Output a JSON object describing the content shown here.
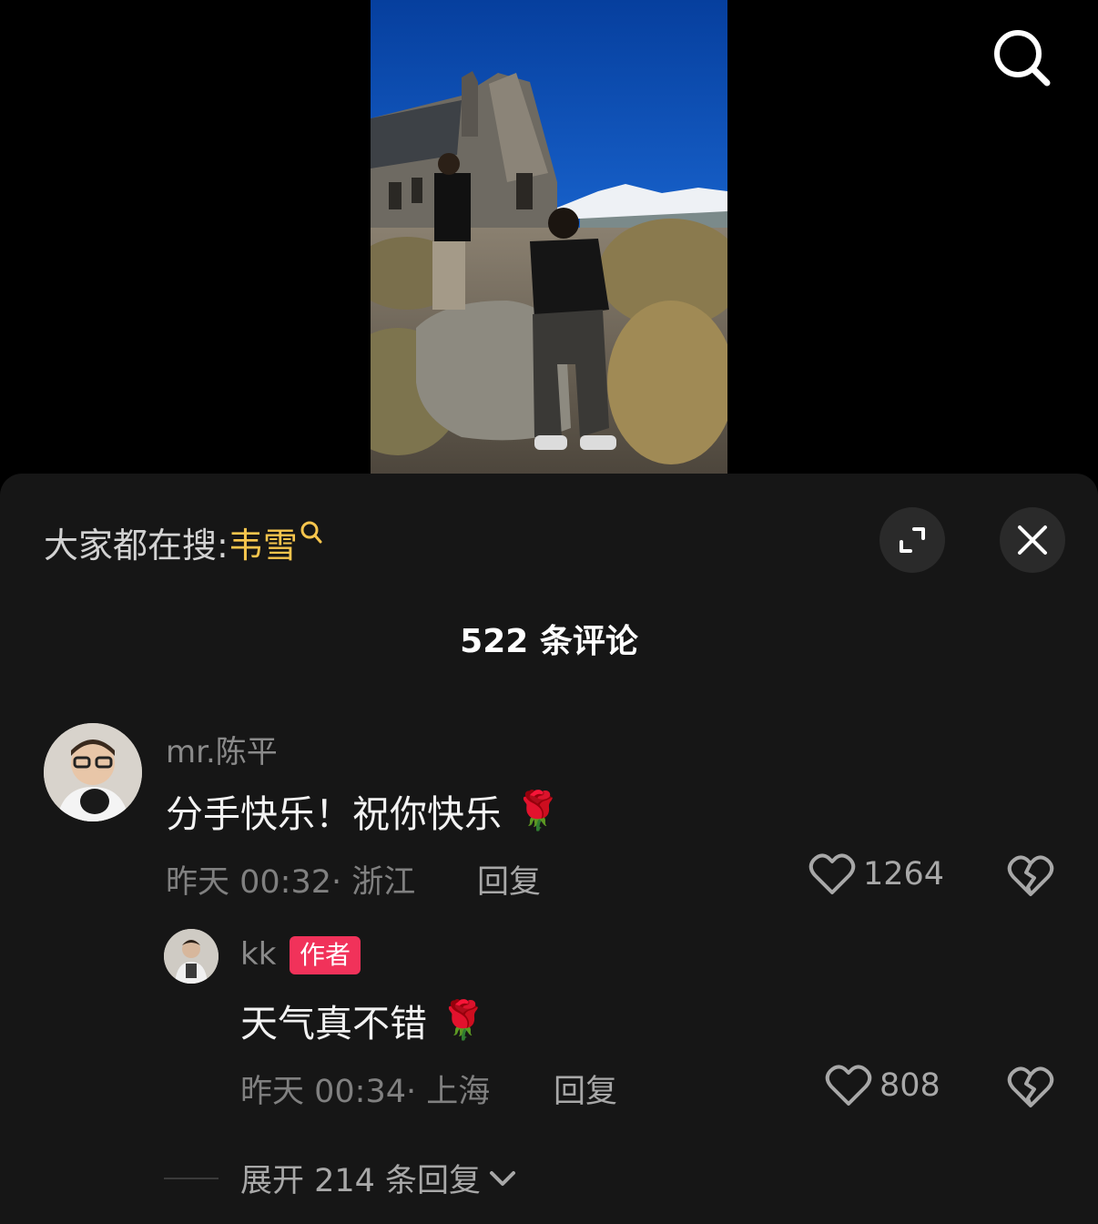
{
  "toolbar": {
    "search_icon": "search-icon"
  },
  "video": {
    "sky_color": "#0a4fbf"
  },
  "sheet": {
    "hot_search_prefix": "大家都在搜:",
    "hot_search_term": "韦雪",
    "expand_icon": "expand-icon",
    "close_icon": "close-icon",
    "comment_count_label": "522 条评论"
  },
  "comments": [
    {
      "username": "mr.陈平",
      "text": "分手快乐！祝你快乐",
      "emoji": "🌹",
      "meta": "昨天 00:32· 浙江",
      "reply_label": "回复",
      "likes": "1264",
      "reply": {
        "username": "kk",
        "badge": "作者",
        "text": "天气真不错",
        "emoji": "🌹",
        "meta": "昨天 00:34· 上海",
        "reply_label": "回复",
        "likes": "808"
      },
      "expand_label": "展开 214 条回复"
    }
  ],
  "colors": {
    "accent_yellow": "#f6c54d",
    "author_badge": "#f1325a",
    "sheet_bg": "#161616"
  }
}
